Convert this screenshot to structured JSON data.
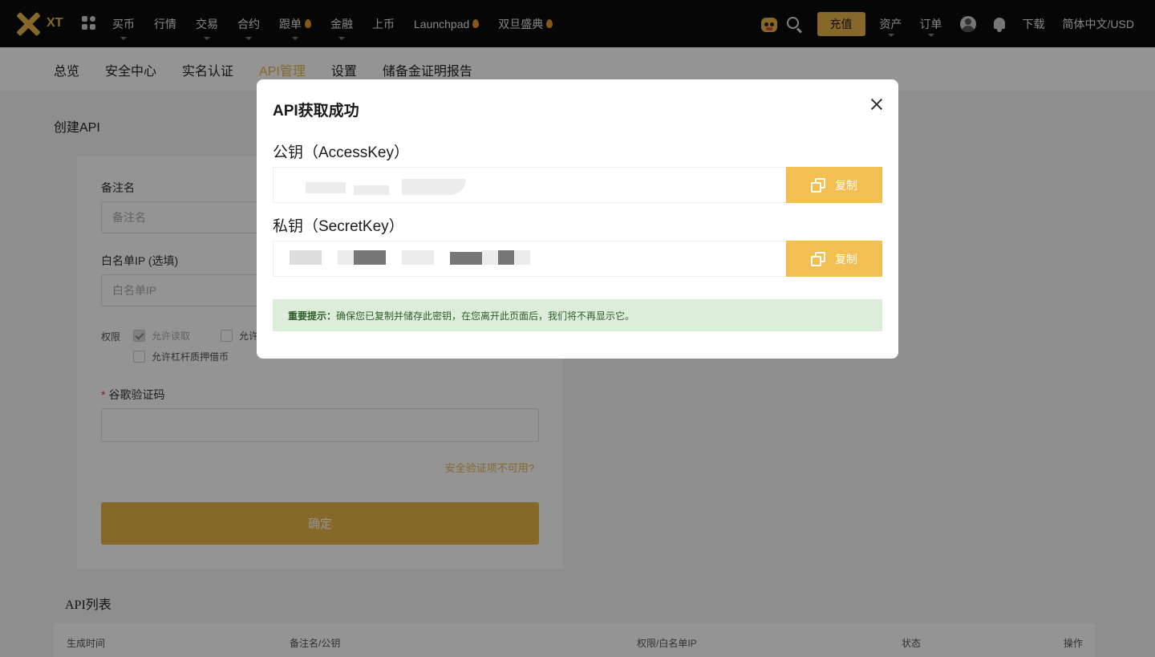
{
  "brand": {
    "logo_text": "XT"
  },
  "topnav": {
    "items": [
      {
        "label": "买币",
        "dropdown": true,
        "hot": false
      },
      {
        "label": "行情",
        "dropdown": false,
        "hot": false
      },
      {
        "label": "交易",
        "dropdown": true,
        "hot": false
      },
      {
        "label": "合约",
        "dropdown": true,
        "hot": false
      },
      {
        "label": "跟单",
        "dropdown": true,
        "hot": true
      },
      {
        "label": "金融",
        "dropdown": true,
        "hot": false
      },
      {
        "label": "上币",
        "dropdown": false,
        "hot": false
      },
      {
        "label": "Launchpad",
        "dropdown": false,
        "hot": true
      },
      {
        "label": "双旦盛典",
        "dropdown": false,
        "hot": true
      }
    ],
    "deposit_label": "充值",
    "assets_label": "资产",
    "orders_label": "订单",
    "download_label": "下载",
    "language_label": "简体中文/USD"
  },
  "subnav": {
    "tabs": [
      {
        "label": "总览",
        "active": false
      },
      {
        "label": "安全中心",
        "active": false
      },
      {
        "label": "实名认证",
        "active": false
      },
      {
        "label": "API管理",
        "active": true
      },
      {
        "label": "设置",
        "active": false
      },
      {
        "label": "储备金证明报告",
        "active": false
      }
    ]
  },
  "create_api": {
    "title": "创建API",
    "remark_label": "备注名",
    "remark_placeholder": "备注名",
    "whitelist_label": "白名单IP (选填)",
    "whitelist_placeholder": "白名单IP",
    "permissions_label": "权限",
    "perm_read": "允许读取",
    "perm_trade_partial": "允许",
    "perm_margin": "允许杠杆质押借币",
    "google_code_label": "谷歌验证码",
    "unavailable_link": "安全验证项不可用?",
    "confirm_label": "确定"
  },
  "api_list": {
    "title": "API列表",
    "columns": [
      "生成时间",
      "备注名/公钥",
      "权限/白名单IP",
      "状态",
      "操作"
    ]
  },
  "modal": {
    "title": "API获取成功",
    "access_key_label": "公钥（AccessKey）",
    "secret_key_label": "私钥（SecretKey）",
    "copy_label": "复制",
    "notice_bold": "重要提示：",
    "notice_text": "确保您已复制并储存此密钥，在您离开此页面后，我们将不再显示它。"
  },
  "colors": {
    "accent": "#e8b34a",
    "copy_button": "#f3be52",
    "nav_bg": "#0b0b0b",
    "notice_bg": "#dcedd9"
  }
}
